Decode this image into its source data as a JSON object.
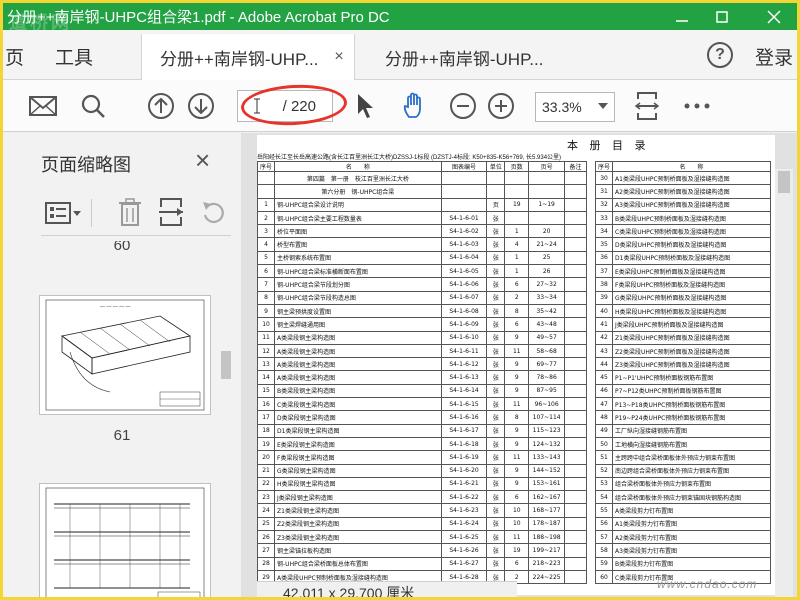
{
  "window": {
    "title": "分册++南岸钢-UHPC组合梁1.pdf - Adobe Acrobat Pro DC",
    "logo_text": "道桥网"
  },
  "menu": {
    "items": [
      "页",
      "工具"
    ]
  },
  "tabs": [
    {
      "label": "分册++南岸钢-UHP...",
      "close": "×",
      "active": true
    },
    {
      "label": "分册++南岸钢-UHP...",
      "active": false
    }
  ],
  "header": {
    "help": "?",
    "login": "登录"
  },
  "toolbar": {
    "page_total": "/ 220",
    "zoom": "33.3%"
  },
  "icons": [
    "mail-icon",
    "search-icon",
    "prev-page-icon",
    "next-page-icon",
    "pointer-icon",
    "hand-icon",
    "zoom-out-icon",
    "zoom-in-icon",
    "fit-page-icon",
    "more-icon"
  ],
  "colors": {
    "titlebar": "#22a243",
    "highlight_oval": "#e8332d",
    "frame": "#f2d633"
  },
  "left_pane": {
    "title": "页面缩略图",
    "close": "×",
    "thumbs": [
      {
        "num": "60"
      },
      {
        "num": "61"
      }
    ]
  },
  "document": {
    "title": "本 册 目 录",
    "project_line": "岳阳经长江至长岳高速公路(含长江百里洲长江大桥)DZSSJ-1标段   (DZSTJ-4标段: K50+835-K56+769, 长5.934公里)",
    "headers_left": [
      "序号",
      "名　　称",
      "图表编号",
      "单位",
      "页数",
      "页号",
      "备注"
    ],
    "headers_right": [
      "序号",
      "名　　称"
    ],
    "rows_left": [
      {
        "no": "",
        "name": "第四篇　第一册　枝江百里洲长江大桥",
        "code": "",
        "unit": "",
        "pages": "",
        "pageno": "",
        "note": ""
      },
      {
        "no": "",
        "name": "第六分册　钢-UHPC组合梁",
        "code": "",
        "unit": "",
        "pages": "",
        "pageno": "",
        "note": ""
      },
      {
        "no": "1",
        "name": "钢-UHPC组合梁设计说明",
        "code": "",
        "unit": "页",
        "pages": "19",
        "pageno": "1~19",
        "note": ""
      },
      {
        "no": "2",
        "name": "钢-UHPC组合梁主要工程数量表",
        "code": "S4-1-6-01",
        "unit": "张",
        "pages": "",
        "pageno": "",
        "note": ""
      },
      {
        "no": "3",
        "name": "桥位平面图",
        "code": "S4-1-6-02",
        "unit": "张",
        "pages": "1",
        "pageno": "20",
        "note": ""
      },
      {
        "no": "4",
        "name": "桥型布置图",
        "code": "S4-1-6-03",
        "unit": "张",
        "pages": "4",
        "pageno": "21~24",
        "note": ""
      },
      {
        "no": "5",
        "name": "主桥钢索系统布置图",
        "code": "S4-1-6-04",
        "unit": "张",
        "pages": "1",
        "pageno": "25",
        "note": ""
      },
      {
        "no": "6",
        "name": "钢-UHPC组合梁标准横断面布置图",
        "code": "S4-1-6-05",
        "unit": "张",
        "pages": "1",
        "pageno": "26",
        "note": ""
      },
      {
        "no": "7",
        "name": "钢-UHPC组合梁节段划分图",
        "code": "S4-1-6-06",
        "unit": "张",
        "pages": "6",
        "pageno": "27~32",
        "note": ""
      },
      {
        "no": "8",
        "name": "钢-UHPC组合梁节段构造总图",
        "code": "S4-1-6-07",
        "unit": "张",
        "pages": "2",
        "pageno": "33~34",
        "note": ""
      },
      {
        "no": "9",
        "name": "钢主梁预拱度设置图",
        "code": "S4-1-6-08",
        "unit": "张",
        "pages": "8",
        "pageno": "35~42",
        "note": ""
      },
      {
        "no": "10",
        "name": "钢主梁焊缝通用图",
        "code": "S4-1-6-09",
        "unit": "张",
        "pages": "6",
        "pageno": "43~48",
        "note": ""
      },
      {
        "no": "11",
        "name": "A类梁段钢主梁构造图",
        "code": "S4-1-6-10",
        "unit": "张",
        "pages": "9",
        "pageno": "49~57",
        "note": ""
      },
      {
        "no": "12",
        "name": "A类梁段钢主梁构造图",
        "code": "S4-1-6-11",
        "unit": "张",
        "pages": "11",
        "pageno": "58~68",
        "note": ""
      },
      {
        "no": "13",
        "name": "A类梁段钢主梁构造图",
        "code": "S4-1-6-12",
        "unit": "张",
        "pages": "9",
        "pageno": "69~77",
        "note": ""
      },
      {
        "no": "14",
        "name": "A类梁段钢主梁构造图",
        "code": "S4-1-6-13",
        "unit": "张",
        "pages": "9",
        "pageno": "78~86",
        "note": ""
      },
      {
        "no": "15",
        "name": "B类梁段钢主梁构造图",
        "code": "S4-1-6-14",
        "unit": "张",
        "pages": "9",
        "pageno": "87~95",
        "note": ""
      },
      {
        "no": "16",
        "name": "C类梁段钢主梁构造图",
        "code": "S4-1-6-15",
        "unit": "张",
        "pages": "11",
        "pageno": "96~106",
        "note": ""
      },
      {
        "no": "17",
        "name": "D类梁段钢主梁构造图",
        "code": "S4-1-6-16",
        "unit": "张",
        "pages": "8",
        "pageno": "107~114",
        "note": ""
      },
      {
        "no": "18",
        "name": "D1类梁段钢主梁构造图",
        "code": "S4-1-6-17",
        "unit": "张",
        "pages": "9",
        "pageno": "115~123",
        "note": ""
      },
      {
        "no": "19",
        "name": "E类梁段钢主梁构造图",
        "code": "S4-1-6-18",
        "unit": "张",
        "pages": "9",
        "pageno": "124~132",
        "note": ""
      },
      {
        "no": "20",
        "name": "F类梁段钢主梁构造图",
        "code": "S4-1-6-19",
        "unit": "张",
        "pages": "11",
        "pageno": "133~143",
        "note": ""
      },
      {
        "no": "21",
        "name": "G类梁段钢主梁构造图",
        "code": "S4-1-6-20",
        "unit": "张",
        "pages": "9",
        "pageno": "144~152",
        "note": ""
      },
      {
        "no": "22",
        "name": "H类梁段钢主梁构造图",
        "code": "S4-1-6-21",
        "unit": "张",
        "pages": "9",
        "pageno": "153~161",
        "note": ""
      },
      {
        "no": "23",
        "name": "J类梁段钢主梁构造图",
        "code": "S4-1-6-22",
        "unit": "张",
        "pages": "6",
        "pageno": "162~167",
        "note": ""
      },
      {
        "no": "24",
        "name": "Z1类梁段钢主梁构造图",
        "code": "S4-1-6-23",
        "unit": "张",
        "pages": "10",
        "pageno": "168~177",
        "note": ""
      },
      {
        "no": "25",
        "name": "Z2类梁段钢主梁构造图",
        "code": "S4-1-6-24",
        "unit": "张",
        "pages": "10",
        "pageno": "178~187",
        "note": ""
      },
      {
        "no": "26",
        "name": "Z3类梁段钢主梁构造图",
        "code": "S4-1-6-25",
        "unit": "张",
        "pages": "11",
        "pageno": "188~198",
        "note": ""
      },
      {
        "no": "27",
        "name": "钢主梁锚拉板构造图",
        "code": "S4-1-6-26",
        "unit": "张",
        "pages": "19",
        "pageno": "199~217",
        "note": ""
      },
      {
        "no": "28",
        "name": "钢-UHPC组合梁桥面板总体布置图",
        "code": "S4-1-6-27",
        "unit": "张",
        "pages": "6",
        "pageno": "218~223",
        "note": ""
      },
      {
        "no": "29",
        "name": "A类梁段UHPC预制桥面板及湿接缝构造图",
        "code": "S4-1-6-28",
        "unit": "张",
        "pages": "2",
        "pageno": "224~225",
        "note": ""
      }
    ],
    "rows_right": [
      {
        "no": "30",
        "name": "A1类梁段UHPC预制桥面板及湿接缝构造图"
      },
      {
        "no": "31",
        "name": "A2类梁段UHPC预制桥面板及湿接缝构造图"
      },
      {
        "no": "32",
        "name": "A3类梁段UHPC预制桥面板及湿接缝构造图"
      },
      {
        "no": "33",
        "name": "B类梁段UHPC预制桥面板及湿接缝构造图"
      },
      {
        "no": "34",
        "name": "C类梁段UHPC预制桥面板及湿接缝构造图"
      },
      {
        "no": "35",
        "name": "D类梁段UHPC预制桥面板及湿接缝构造图"
      },
      {
        "no": "36",
        "name": "D1类梁段UHPC预制桥面板及湿接缝构造图"
      },
      {
        "no": "37",
        "name": "E类梁段UHPC预制桥面板及湿接缝构造图"
      },
      {
        "no": "38",
        "name": "F类梁段UHPC预制桥面板及湿接缝构造图"
      },
      {
        "no": "39",
        "name": "G类梁段UHPC预制桥面板及湿接缝构造图"
      },
      {
        "no": "40",
        "name": "H类梁段UHPC预制桥面板及湿接缝构造图"
      },
      {
        "no": "41",
        "name": "J类梁段UHPC预制桥面板及湿接缝构造图"
      },
      {
        "no": "42",
        "name": "Z1类梁段UHPC预制桥面板及湿接缝构造图"
      },
      {
        "no": "43",
        "name": "Z2类梁段UHPC预制桥面板及湿接缝构造图"
      },
      {
        "no": "44",
        "name": "Z3类梁段UHPC预制桥面板及湿接缝构造图"
      },
      {
        "no": "45",
        "name": "P1~P1'UHPC预制桥面板钢筋布置图"
      },
      {
        "no": "46",
        "name": "P7~P12类UHPC预制桥面板钢筋布置图"
      },
      {
        "no": "47",
        "name": "P13~P18类UHPC预制桥面板钢筋布置图"
      },
      {
        "no": "48",
        "name": "P19~P24类UHPC预制桥面板钢筋布置图"
      },
      {
        "no": "49",
        "name": "工厂纵向湿接缝钢筋布置图"
      },
      {
        "no": "50",
        "name": "工地横向湿接缝钢筋布置图"
      },
      {
        "no": "51",
        "name": "主跨跨中组合梁桥面板体外预应力钢束布置图"
      },
      {
        "no": "52",
        "name": "南边跨组合梁桥面板体外预应力钢束布置图"
      },
      {
        "no": "53",
        "name": "组合梁桥面板体外预应力钢束布置图"
      },
      {
        "no": "54",
        "name": "组合梁桥面板体外预应力钢束锚固块钢筋构造图"
      },
      {
        "no": "55",
        "name": "A类梁段剪力钉布置图"
      },
      {
        "no": "56",
        "name": "A1类梁段剪力钉布置图"
      },
      {
        "no": "57",
        "name": "A2类梁段剪力钉布置图"
      },
      {
        "no": "58",
        "name": "A3类梁段剪力钉布置图"
      },
      {
        "no": "59",
        "name": "B类梁段剪力钉布置图"
      },
      {
        "no": "60",
        "name": "C类梁段剪力钉布置图"
      }
    ],
    "page_size": "42.011 x 29.700 厘米",
    "watermark": "www.cndao.com"
  }
}
